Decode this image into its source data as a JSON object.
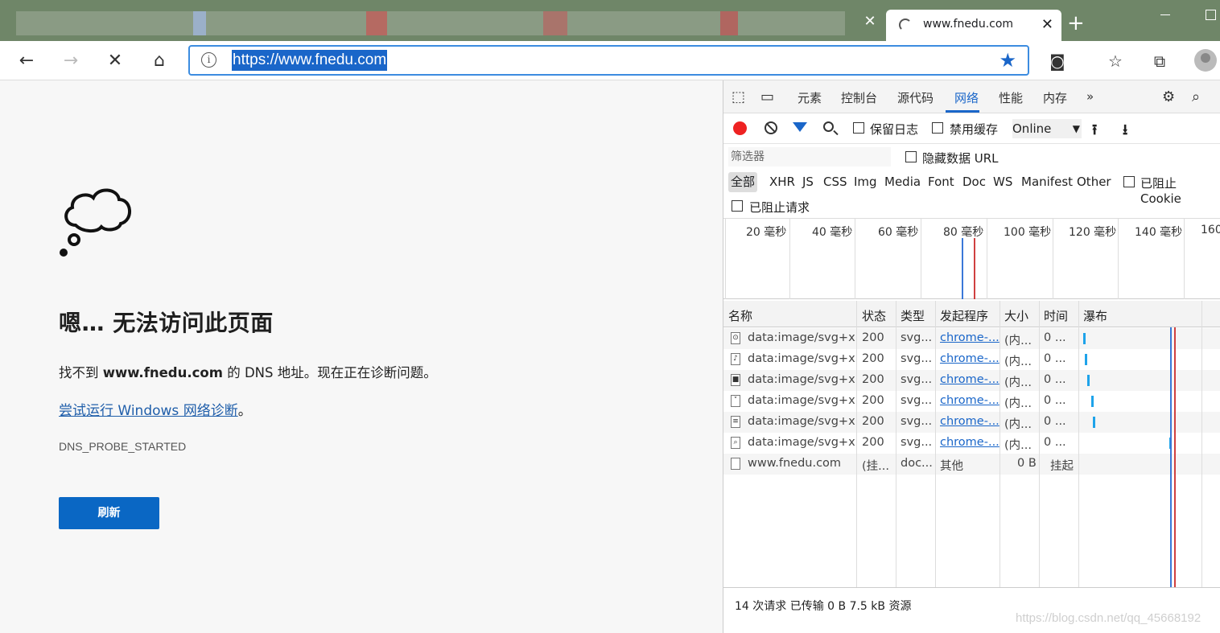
{
  "browser": {
    "active_tab_title": "www.fnedu.com",
    "url": "https://www.fnedu.com",
    "accent_color": "#1a66c9"
  },
  "error_page": {
    "title": "嗯… 无法访问此页面",
    "desc_prefix": "找不到 ",
    "desc_domain": "www.fnedu.com",
    "desc_suffix": " 的 DNS 地址。现在正在诊断问题。",
    "link_text": "尝试运行 Windows 网络诊断",
    "link_suffix": "。",
    "error_code": "DNS_PROBE_STARTED",
    "reload_label": "刷新",
    "button_color": "#0a67c4"
  },
  "devtools": {
    "tabs": [
      "元素",
      "控制台",
      "源代码",
      "网络",
      "性能",
      "内存"
    ],
    "active_tab": "网络",
    "more": "»",
    "toolbar": {
      "preserve_log": "保留日志",
      "disable_cache": "禁用缓存",
      "throttle": "Online"
    },
    "filter_placeholder": "筛选器",
    "hide_data_urls": "隐藏数据 URL",
    "types": [
      "全部",
      "XHR",
      "JS",
      "CSS",
      "Img",
      "Media",
      "Font",
      "Doc",
      "WS",
      "Manifest",
      "Other"
    ],
    "blocked_cookies": "已阻止 Cookie",
    "blocked_requests": "已阻止请求",
    "timeline_labels": [
      "20 毫秒",
      "40 毫秒",
      "60 毫秒",
      "80 毫秒",
      "100 毫秒",
      "120 毫秒",
      "140 毫秒",
      "160"
    ],
    "columns": [
      "名称",
      "状态",
      "类型",
      "发起程序",
      "大小",
      "时间",
      "瀑布"
    ],
    "rows": [
      {
        "icon": "⊙",
        "name": "data:image/svg+x...",
        "status": "200",
        "type": "svg...",
        "initiator": "chrome-...",
        "size": "(内...",
        "time": "0 ..."
      },
      {
        "icon": "♪",
        "name": "data:image/svg+x...",
        "status": "200",
        "type": "svg...",
        "initiator": "chrome-...",
        "size": "(内...",
        "time": "0 ..."
      },
      {
        "icon": "■",
        "name": "data:image/svg+x...",
        "status": "200",
        "type": "svg...",
        "initiator": "chrome-...",
        "size": "(内...",
        "time": "0 ..."
      },
      {
        "icon": "˅",
        "name": "data:image/svg+x...",
        "status": "200",
        "type": "svg...",
        "initiator": "chrome-...",
        "size": "(内...",
        "time": "0 ..."
      },
      {
        "icon": "≡",
        "name": "data:image/svg+x...",
        "status": "200",
        "type": "svg...",
        "initiator": "chrome-...",
        "size": "(内...",
        "time": "0 ..."
      },
      {
        "icon": "⌕",
        "name": "data:image/svg+x...",
        "status": "200",
        "type": "svg...",
        "initiator": "chrome-...",
        "size": "(内...",
        "time": "0 ..."
      },
      {
        "icon": "",
        "name": "www.fnedu.com",
        "status": "(挂...",
        "type": "doc...",
        "initiator": "其他",
        "size": "0 B",
        "time": "挂起"
      }
    ],
    "status_bar": "14 次请求  已传输 0 B  7.5 kB 资源"
  },
  "watermark": "https://blog.csdn.net/qq_45668192"
}
